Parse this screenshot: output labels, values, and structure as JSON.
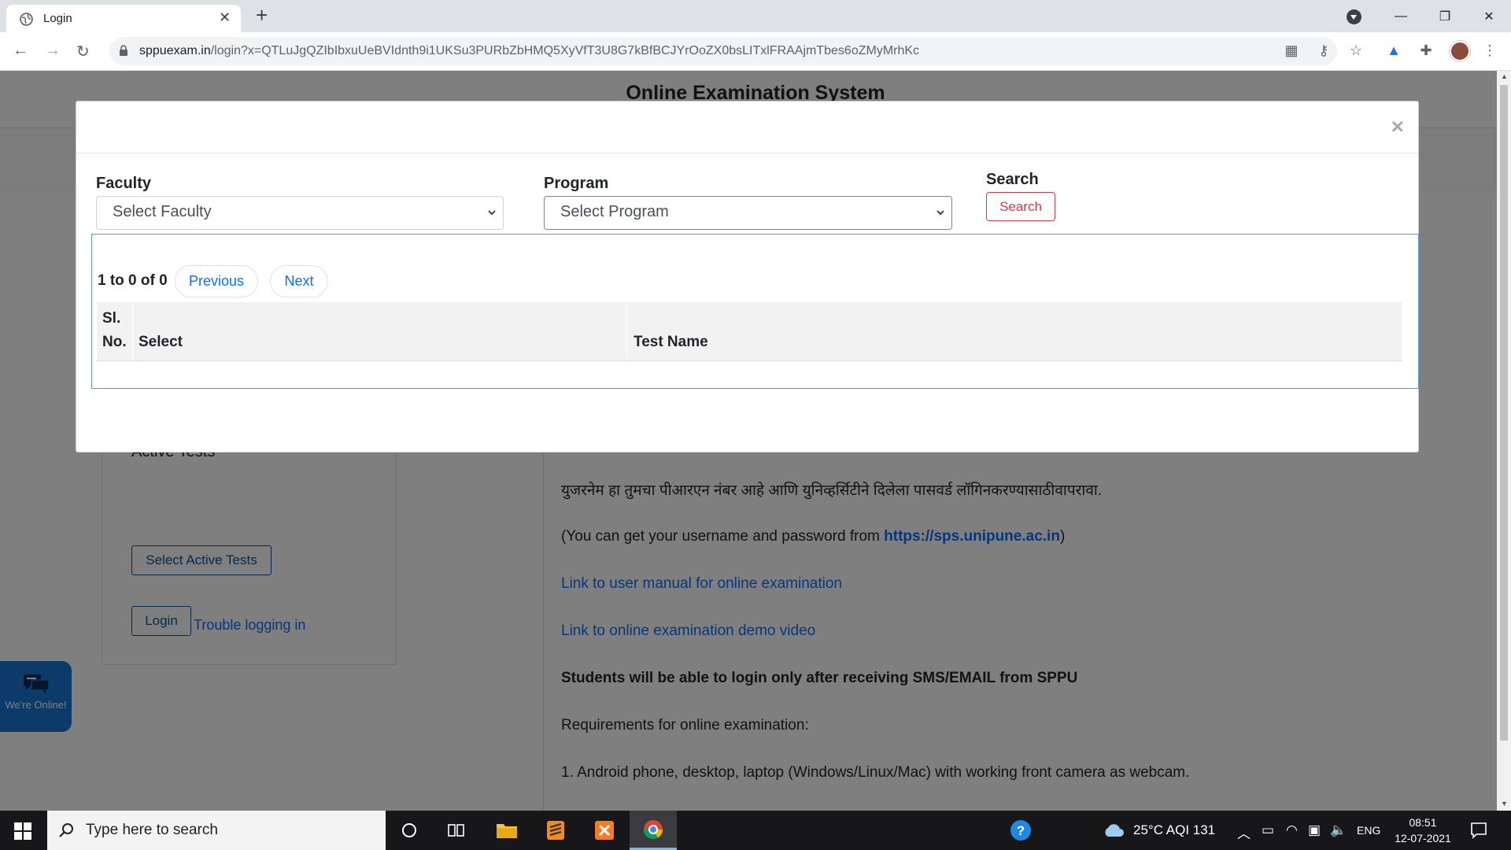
{
  "browser": {
    "tab_title": "Login",
    "url_host": "sppuexam.in",
    "url_path": "/login?x=QTLuJgQZIbIbxuUeBVIdnth9i1UKSu3PURbZbHMQ5XyVfT3U8G7kBfBCJYrOoZX0bsLITxlFRAAjmTbes6oZMyMrhKc"
  },
  "page": {
    "site_title": "Online Examination System",
    "password_mask": "••••",
    "active_tests_label": "Active Tests *",
    "select_active_tests_label": "Select Active Tests",
    "login_label": "Login",
    "trouble_label": "Trouble logging in",
    "info": {
      "marathi_note": "युजरनेम हा तुमचा पीआरएन नंबर आहे आणि युनिव्हर्सिटीने दिलेला पासवर्ड लॉगिनकरण्यासाठीवापरावा.",
      "credentials_prefix": "(You can get your username and password from ",
      "credentials_link": "https://sps.unipune.ac.in",
      "credentials_suffix": ")",
      "manual_link": "Link to user manual for online examination",
      "demo_link": "Link to online examination demo video",
      "sms_notice": "Students will be able to login only after receiving SMS/EMAIL from SPPU",
      "requirements_heading": "Requirements for online examination:",
      "requirement_1": "1. Android phone, desktop, laptop (Windows/Linux/Mac) with working front camera as webcam."
    },
    "chat_widget_text": "We're Online!"
  },
  "modal": {
    "close_glyph": "×",
    "faculty_label": "Faculty",
    "faculty_selected": "Select Faculty",
    "program_label": "Program",
    "program_selected": "Select Program",
    "search_label": "Search",
    "search_button": "Search",
    "range_text": "1 to 0 of 0",
    "previous_label": "Previous",
    "next_label": "Next",
    "table_headers": {
      "sl_no_line1": "Sl.",
      "sl_no_line2": "No.",
      "select": "Select",
      "test_name": "Test Name"
    }
  },
  "taskbar": {
    "search_placeholder": "Type here to search",
    "weather": "25°C  AQI 131",
    "language": "ENG",
    "time": "08:51",
    "date": "12-07-2021"
  },
  "colors": {
    "link_blue": "#0d6efd",
    "danger_red": "#dc3545",
    "results_border": "#5b9bd5",
    "chat_blue": "#1976d2"
  }
}
